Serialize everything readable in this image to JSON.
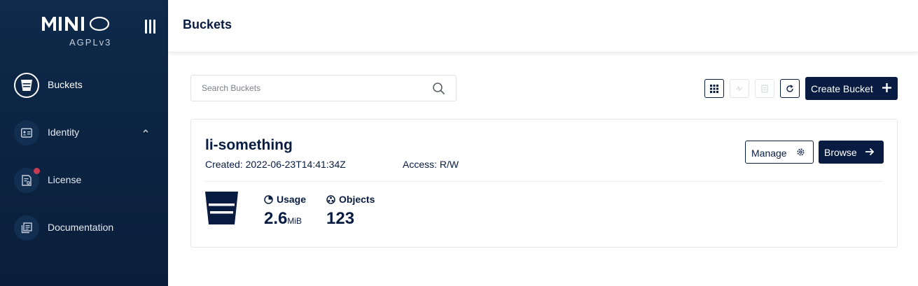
{
  "app": {
    "logo_text": "MINIO",
    "license_label": "AGPLv3"
  },
  "sidebar": {
    "items": [
      {
        "label": "Buckets",
        "icon": "bucket-icon",
        "active": true
      },
      {
        "label": "Identity",
        "icon": "id-card-icon",
        "expanded": true
      },
      {
        "label": "License",
        "icon": "license-icon",
        "notification": true
      },
      {
        "label": "Documentation",
        "icon": "documentation-icon"
      }
    ]
  },
  "header": {
    "title": "Buckets"
  },
  "toolbar": {
    "search_placeholder": "Search Buckets",
    "create_label": "Create Bucket"
  },
  "buckets": [
    {
      "name": "li-something",
      "created": "Created: 2022-06-23T14:41:34Z",
      "access": "Access: R/W",
      "manage_label": "Manage",
      "browse_label": "Browse",
      "usage_label": "Usage",
      "usage_value": "2.6",
      "usage_unit": "MiB",
      "objects_label": "Objects",
      "objects_value": "123"
    }
  ],
  "colors": {
    "sidebar_bg": "#0b2240",
    "primary": "#081c42",
    "notification": "#c83b51"
  }
}
